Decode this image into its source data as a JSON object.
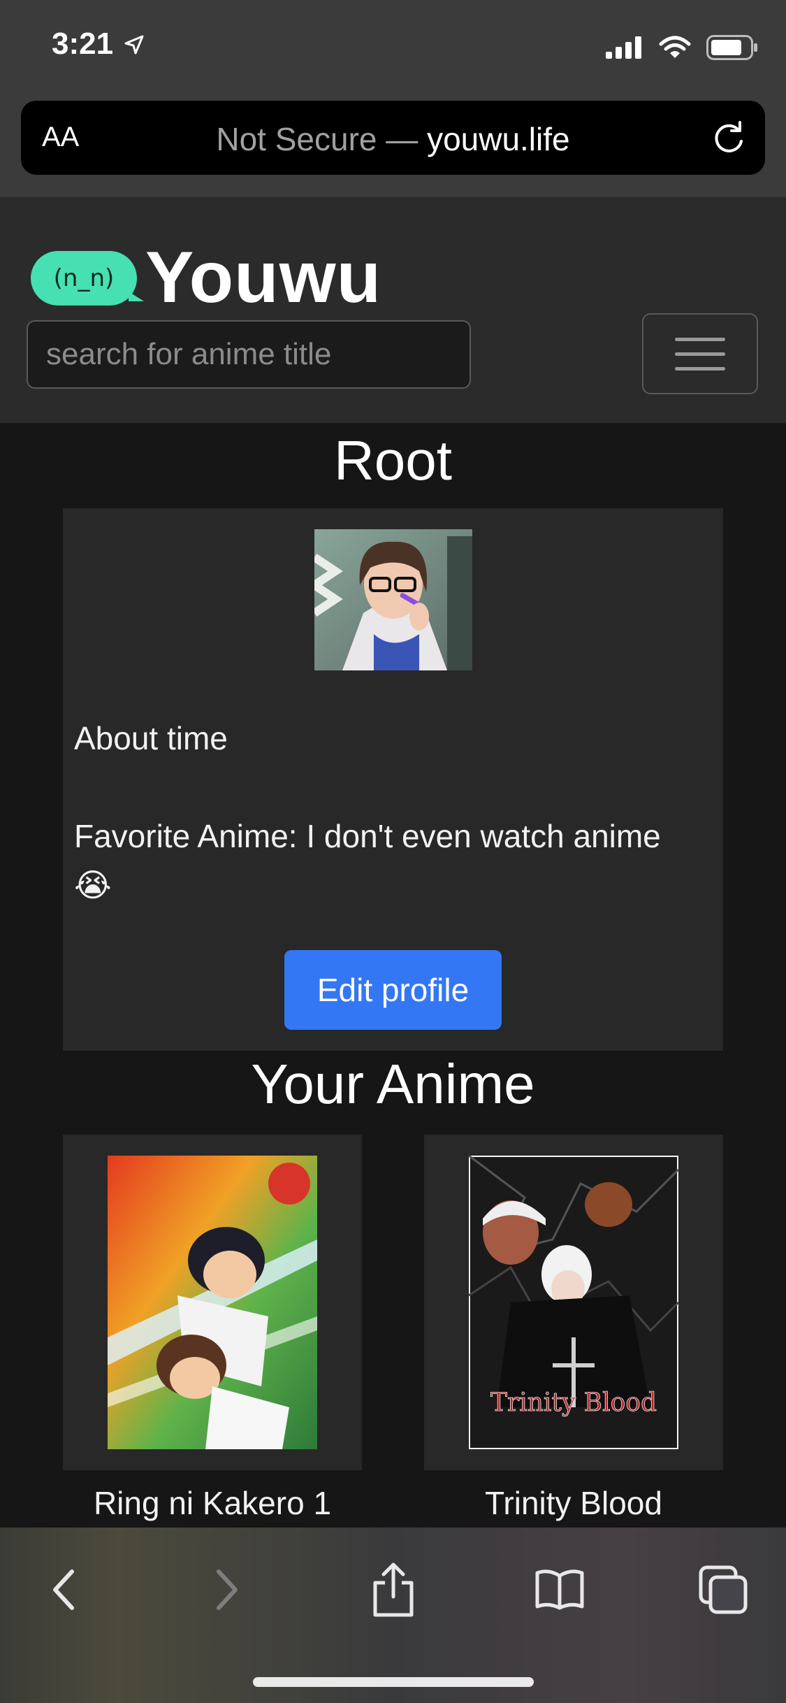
{
  "status_bar": {
    "time": "3:21"
  },
  "browser": {
    "aa_label": "AA",
    "url_not_secure": "Not Secure —",
    "url_host": "youwu.life"
  },
  "site": {
    "logo_bubble": "(n_n)",
    "logo_text": "Youwu",
    "search_placeholder": "search for anime title"
  },
  "profile": {
    "username": "Root",
    "about": "About time",
    "favorite": "Favorite Anime: I don't even watch anime",
    "favorite_emoji": "😭",
    "edit_button": "Edit profile"
  },
  "your_anime": {
    "heading": "Your Anime",
    "items": [
      {
        "title": "Ring ni Kakero 1"
      },
      {
        "title": "Trinity Blood",
        "poster_text": "Trinity Blood"
      }
    ]
  }
}
